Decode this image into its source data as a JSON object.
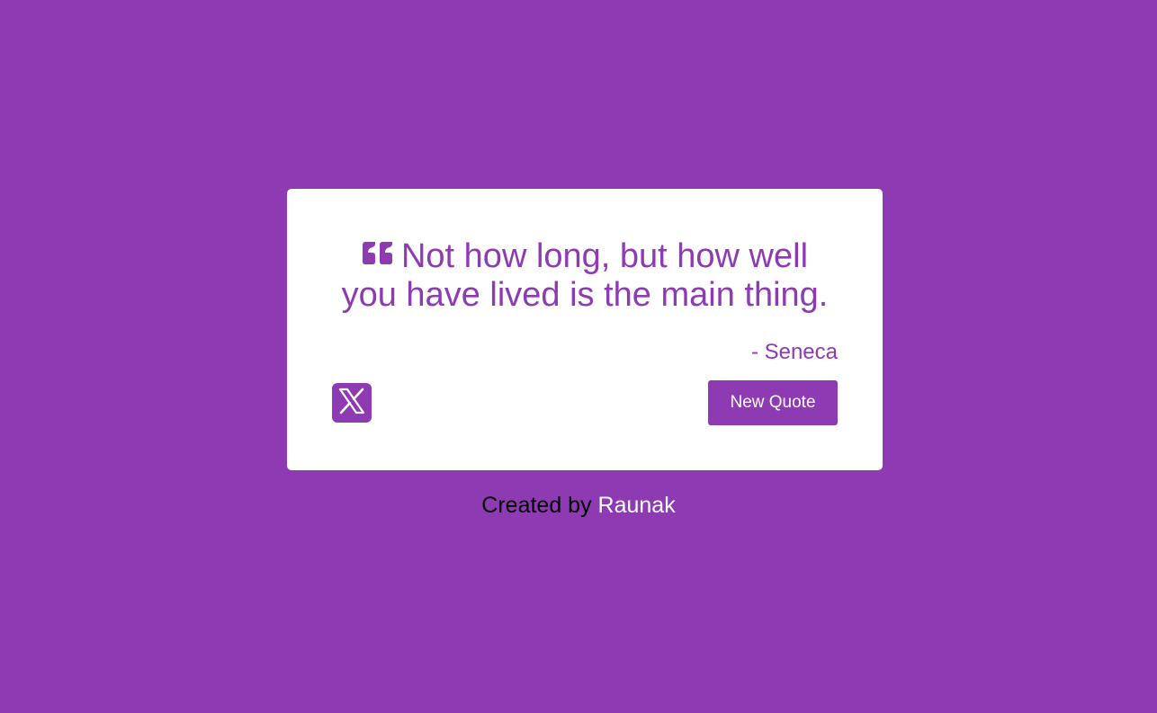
{
  "colors": {
    "background": "#8e3ab3",
    "card": "#ffffff",
    "accent": "#8e3ab3",
    "button_text": "#ffffff",
    "footer_text": "#000000",
    "footer_link": "#ffffff"
  },
  "quote": {
    "icon": "quote-left-icon",
    "text": "Not how long, but how well you have lived is the main thing.",
    "author": "- Seneca"
  },
  "actions": {
    "tweet_icon": "x-logo-icon",
    "new_quote_label": "New Quote"
  },
  "footer": {
    "prefix": "Created by ",
    "author_link": "Raunak"
  }
}
